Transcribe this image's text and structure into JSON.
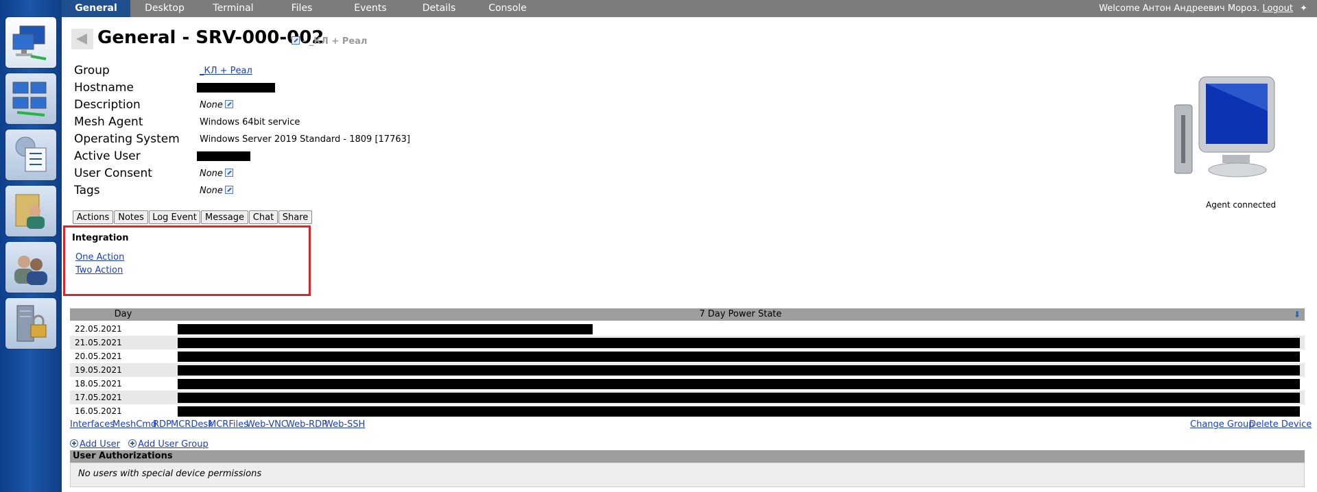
{
  "nav": {
    "tabs": [
      {
        "label": "General",
        "active": true
      },
      {
        "label": "Desktop"
      },
      {
        "label": "Terminal"
      },
      {
        "label": "Files"
      },
      {
        "label": "Events"
      },
      {
        "label": "Details"
      },
      {
        "label": "Console"
      }
    ],
    "welcome_text": "Welcome Антон Андреевич Мороз.",
    "logout_label": "Logout"
  },
  "sidebar": {
    "items": [
      {
        "name": "my-devices",
        "icon": "computer-network-icon",
        "active": true
      },
      {
        "name": "my-desktop",
        "icon": "multi-monitor-icon"
      },
      {
        "name": "my-events",
        "icon": "checklist-gear-icon"
      },
      {
        "name": "my-files",
        "icon": "user-folder-icon"
      },
      {
        "name": "my-users",
        "icon": "users-icon"
      },
      {
        "name": "my-server",
        "icon": "server-lock-icon"
      }
    ]
  },
  "header": {
    "title": "General - SRV-000-002",
    "suffix": "- _КЛ + Реал"
  },
  "info": {
    "group_label": "Group",
    "group_value": "_КЛ + Реал",
    "hostname_label": "Hostname",
    "description_label": "Description",
    "description_value": "None",
    "mesh_agent_label": "Mesh Agent",
    "mesh_agent_value": "Windows 64bit service",
    "os_label": "Operating System",
    "os_value": "Windows Server 2019 Standard - 1809 [17763]",
    "active_user_label": "Active User",
    "user_consent_label": "User Consent",
    "user_consent_value": "None",
    "tags_label": "Tags",
    "tags_value": "None"
  },
  "agent_status": "Agent connected",
  "actions": [
    "Actions",
    "Notes",
    "Log Event",
    "Message",
    "Chat",
    "Share"
  ],
  "integration": {
    "title": "Integration",
    "links": [
      "One Action",
      "Two Action"
    ]
  },
  "power_table": {
    "col_day": "Day",
    "col_state": "7 Day Power State",
    "rows": [
      {
        "day": "22.05.2021",
        "fraction": 0.37
      },
      {
        "day": "21.05.2021",
        "fraction": 1.0
      },
      {
        "day": "20.05.2021",
        "fraction": 1.0
      },
      {
        "day": "19.05.2021",
        "fraction": 1.0
      },
      {
        "day": "18.05.2021",
        "fraction": 1.0
      },
      {
        "day": "17.05.2021",
        "fraction": 1.0
      },
      {
        "day": "16.05.2021",
        "fraction": 1.0
      }
    ]
  },
  "bottom_links": {
    "left": [
      "Interfaces",
      "MeshCmd",
      "RDP",
      "MCRDesk",
      "MCRFiles",
      "Web-VNC",
      "Web-RDP",
      "Web-SSH"
    ],
    "right": [
      "Change Group",
      "Delete Device"
    ]
  },
  "user_actions": {
    "add_user": "Add User",
    "add_user_group": "Add User Group"
  },
  "user_auth": {
    "title": "User Authorizations",
    "empty_text": "No users with special device permissions"
  }
}
